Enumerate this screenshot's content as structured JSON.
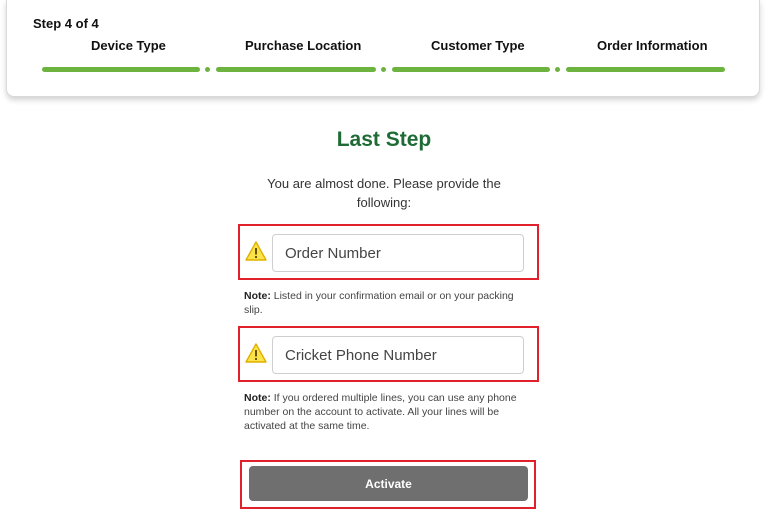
{
  "stepper": {
    "count_label": "Step 4 of 4",
    "steps": [
      {
        "label": "Device Type"
      },
      {
        "label": "Purchase Location"
      },
      {
        "label": "Customer Type"
      },
      {
        "label": "Order Information"
      }
    ],
    "progress_color": "#6cb33f",
    "completed_steps": 4
  },
  "main": {
    "title": "Last Step",
    "subtitle": "You are almost done. Please provide the following:",
    "title_color": "#1f6b36"
  },
  "order_field": {
    "placeholder": "Order Number",
    "value": "",
    "icon": "warning-icon",
    "note_prefix": "Note:",
    "note_text": " Listed in your confirmation email or on your packing slip."
  },
  "phone_field": {
    "placeholder": "Cricket Phone Number",
    "value": "",
    "icon": "warning-icon",
    "note_prefix": "Note:",
    "note_text": "  If you ordered multiple lines, you can use any phone number on the account to activate.  All your lines will be activated at the same time."
  },
  "activate_button": {
    "label": "Activate",
    "color": "#6f6f6f"
  },
  "highlight_color": "#e0202a",
  "warning_color": "#f2c200"
}
